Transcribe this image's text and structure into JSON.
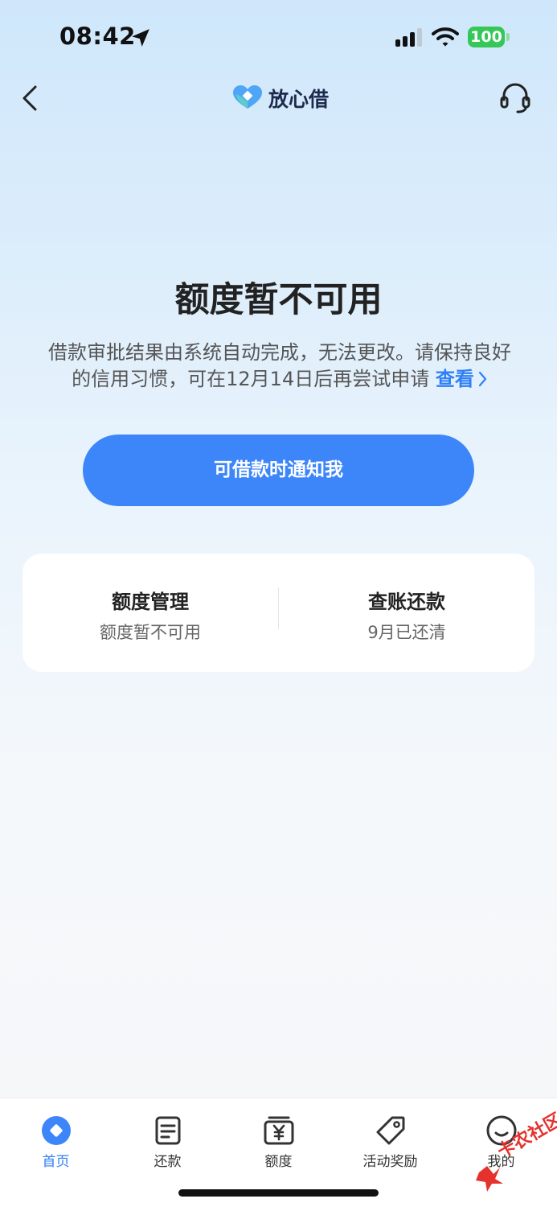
{
  "status_bar": {
    "time": "08:42",
    "battery": "100"
  },
  "nav": {
    "brand_name": "放心借"
  },
  "main": {
    "title": "额度暂不可用",
    "message_line1": "借款审批结果由系统自动完成，无法更改。请保持良好",
    "message_line2": "的信用习惯，可在12月14日后再尝试申请",
    "view_link": "查看",
    "notify_button": "可借款时通知我"
  },
  "card": {
    "items": [
      {
        "title": "额度管理",
        "subtitle": "额度暂不可用"
      },
      {
        "title": "查账还款",
        "subtitle": "9月已还清"
      }
    ]
  },
  "tab_bar": {
    "items": [
      {
        "label": "首页",
        "icon": "home-diamond-icon",
        "active": true
      },
      {
        "label": "还款",
        "icon": "bill-icon"
      },
      {
        "label": "额度",
        "icon": "yuan-card-icon"
      },
      {
        "label": "活动奖励",
        "icon": "tag-icon"
      },
      {
        "label": "我的",
        "icon": "smile-face-icon"
      }
    ]
  },
  "watermark": {
    "text": "卡农社区"
  },
  "colors": {
    "accent": "#3d86f9",
    "link": "#2f7ff6",
    "battery": "#36c759"
  }
}
